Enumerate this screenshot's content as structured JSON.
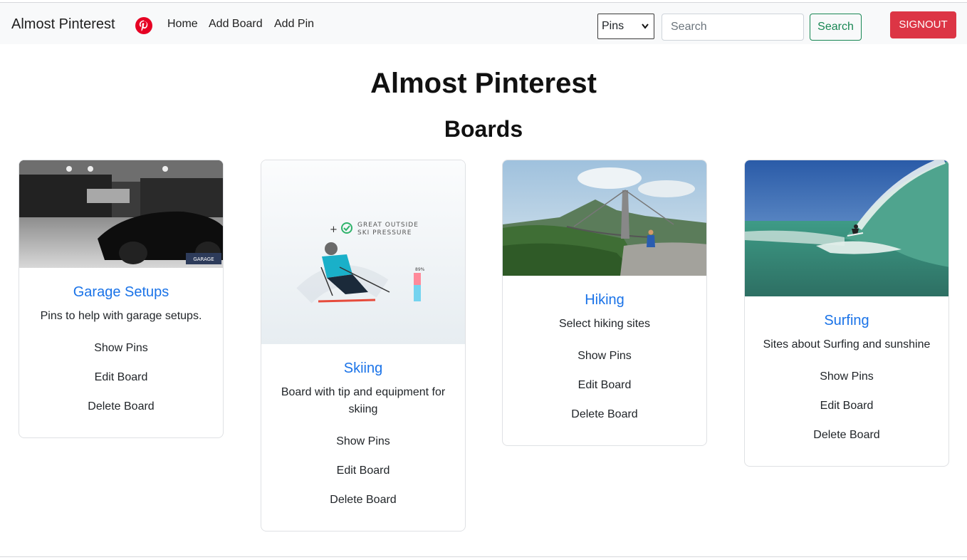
{
  "navbar": {
    "brand": "Almost Pinterest",
    "logo_icon": "pinterest-logo-icon",
    "links": [
      "Home",
      "Add Board",
      "Add Pin"
    ],
    "select_value": "Pins",
    "search_placeholder": "Search",
    "search_button": "Search",
    "signout_button": "SIGNOUT"
  },
  "main": {
    "title": "Almost Pinterest",
    "section": "Boards"
  },
  "boards": [
    {
      "title": "Garage Setups",
      "description": "Pins to help with garage setups.",
      "show": "Show Pins",
      "edit": "Edit Board",
      "delete": "Delete Board",
      "image_caption": "GARAGE"
    },
    {
      "title": "Skiing",
      "description": "Board with tip and equipment for skiing",
      "show": "Show Pins",
      "edit": "Edit Board",
      "delete": "Delete Board",
      "image_line1": "GREAT OUTSIDE",
      "image_line2": "SKI PRESSURE",
      "image_percent": "89%"
    },
    {
      "title": "Hiking",
      "description": "Select hiking sites",
      "show": "Show Pins",
      "edit": "Edit Board",
      "delete": "Delete Board"
    },
    {
      "title": "Surfing",
      "description": "Sites about Surfing and sunshine",
      "show": "Show Pins",
      "edit": "Edit Board",
      "delete": "Delete Board"
    }
  ],
  "colors": {
    "accent": "#1a73e8",
    "danger": "#dc3545",
    "success": "#198754",
    "navbar_bg": "#f8f9fa"
  }
}
